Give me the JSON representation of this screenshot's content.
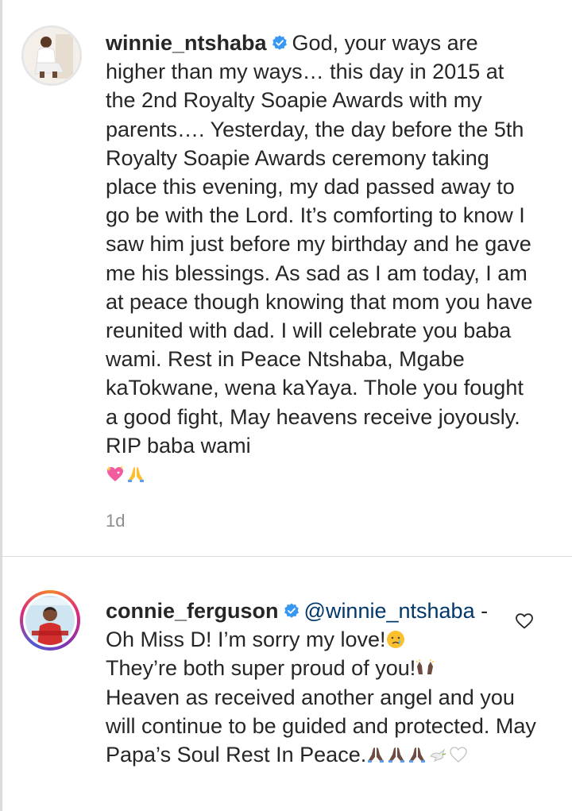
{
  "comments": [
    {
      "username": "winnie_ntshaba",
      "verified": true,
      "text": "God, your ways are higher than my ways… this day in 2015 at the 2nd Royalty Soapie Awards with my parents…. Yesterday, the day before the 5th Royalty Soapie Awards ceremony taking place this evening, my dad passed away to go be with the Lord. It’s comforting to know I saw him just before my birthday and he gave me his blessings. As sad as I am today, I am at peace though knowing that mom you have reunited with dad. I will celebrate you baba wami. Rest in Peace Ntshaba, Mgabe kaTokwane, wena kaYaya. Thole you fought a good fight, May heavens receive joyously. RIP baba wami",
      "emojis": [
        "sparkling-heart",
        "folded-hands"
      ],
      "timestamp": "1d"
    },
    {
      "username": "connie_ferguson",
      "verified": true,
      "mention": "@winnie_ntshaba",
      "text_line1": " -",
      "text": "Oh Miss D! I’m sorry my love!",
      "text2": "They’re both super proud of you!",
      "text3": "Heaven as received another angel and you will continue to be guided and protected. May Papa’s Soul Rest In Peace.",
      "emojis": [
        "crying-face",
        "raising-hands",
        "folded-hands",
        "folded-hands",
        "folded-hands",
        "dove",
        "white-heart"
      ]
    }
  ],
  "colors": {
    "verified": "#3897f0",
    "mention": "#00376b",
    "meta": "#8e8e8e",
    "divider": "#dbdbdb"
  }
}
